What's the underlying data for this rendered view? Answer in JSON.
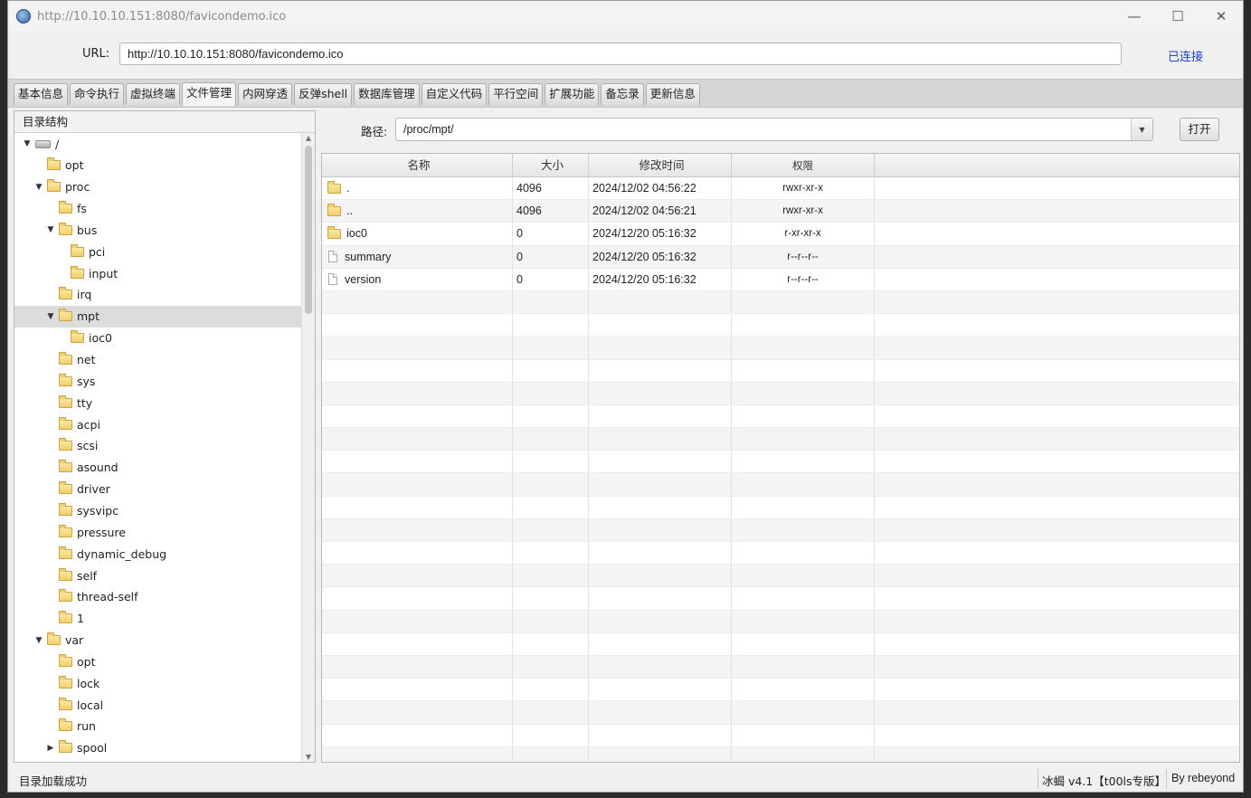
{
  "window": {
    "title": "http://10.10.10.151:8080/favicondemo.ico"
  },
  "url": {
    "label": "URL:",
    "value": "http://10.10.10.151:8080/favicondemo.ico",
    "status": "已连接"
  },
  "tabs": [
    {
      "label": "基本信息"
    },
    {
      "label": "命令执行"
    },
    {
      "label": "虚拟终端"
    },
    {
      "label": "文件管理",
      "active": true
    },
    {
      "label": "内网穿透"
    },
    {
      "label": "反弹shell"
    },
    {
      "label": "数据库管理"
    },
    {
      "label": "自定义代码"
    },
    {
      "label": "平行空间"
    },
    {
      "label": "扩展功能"
    },
    {
      "label": "备忘录"
    },
    {
      "label": "更新信息"
    }
  ],
  "tree": {
    "header": "目录结构",
    "nodes": [
      {
        "label": "/",
        "depth": 0,
        "expanded": true,
        "icon": "drive-icon"
      },
      {
        "label": "opt",
        "depth": 1
      },
      {
        "label": "proc",
        "depth": 1,
        "expanded": true
      },
      {
        "label": "fs",
        "depth": 2
      },
      {
        "label": "bus",
        "depth": 2,
        "expanded": true
      },
      {
        "label": "pci",
        "depth": 3
      },
      {
        "label": "input",
        "depth": 3
      },
      {
        "label": "irq",
        "depth": 2
      },
      {
        "label": "mpt",
        "depth": 2,
        "expanded": true,
        "selected": true
      },
      {
        "label": "ioc0",
        "depth": 3
      },
      {
        "label": "net",
        "depth": 2
      },
      {
        "label": "sys",
        "depth": 2
      },
      {
        "label": "tty",
        "depth": 2
      },
      {
        "label": "acpi",
        "depth": 2
      },
      {
        "label": "scsi",
        "depth": 2
      },
      {
        "label": "asound",
        "depth": 2
      },
      {
        "label": "driver",
        "depth": 2
      },
      {
        "label": "sysvipc",
        "depth": 2
      },
      {
        "label": "pressure",
        "depth": 2
      },
      {
        "label": "dynamic_debug",
        "depth": 2
      },
      {
        "label": "self",
        "depth": 2
      },
      {
        "label": "thread-self",
        "depth": 2
      },
      {
        "label": "1",
        "depth": 2
      },
      {
        "label": "var",
        "depth": 1,
        "expanded": true
      },
      {
        "label": "opt",
        "depth": 2
      },
      {
        "label": "lock",
        "depth": 2
      },
      {
        "label": "local",
        "depth": 2
      },
      {
        "label": "run",
        "depth": 2
      },
      {
        "label": "spool",
        "depth": 2,
        "expanded": false
      }
    ]
  },
  "path": {
    "label": "路径:",
    "value": "/proc/mpt/",
    "open_label": "打开"
  },
  "file_table": {
    "headers": [
      "名称",
      "大小",
      "修改时间",
      "权限"
    ],
    "rows": [
      {
        "name": ".",
        "type": "folder",
        "size": "4096",
        "modified": "2024/12/02 04:56:22",
        "perm": "rwxr-xr-x"
      },
      {
        "name": "..",
        "type": "folder",
        "size": "4096",
        "modified": "2024/12/02 04:56:21",
        "perm": "rwxr-xr-x"
      },
      {
        "name": "ioc0",
        "type": "folder",
        "size": "0",
        "modified": "2024/12/20 05:16:32",
        "perm": "r-xr-xr-x"
      },
      {
        "name": "summary",
        "type": "file",
        "size": "0",
        "modified": "2024/12/20 05:16:32",
        "perm": "r--r--r--"
      },
      {
        "name": "version",
        "type": "file",
        "size": "0",
        "modified": "2024/12/20 05:16:32",
        "perm": "r--r--r--"
      }
    ],
    "empty_rows": 21
  },
  "status": {
    "message": "目录加载成功",
    "version": "冰蝎 v4.1【t00ls专版】",
    "author": "By rebeyond"
  },
  "colors": {
    "accent_link": "#1a3fd1",
    "selection": "#dcdcdc",
    "folder": "#f1cf6c"
  }
}
